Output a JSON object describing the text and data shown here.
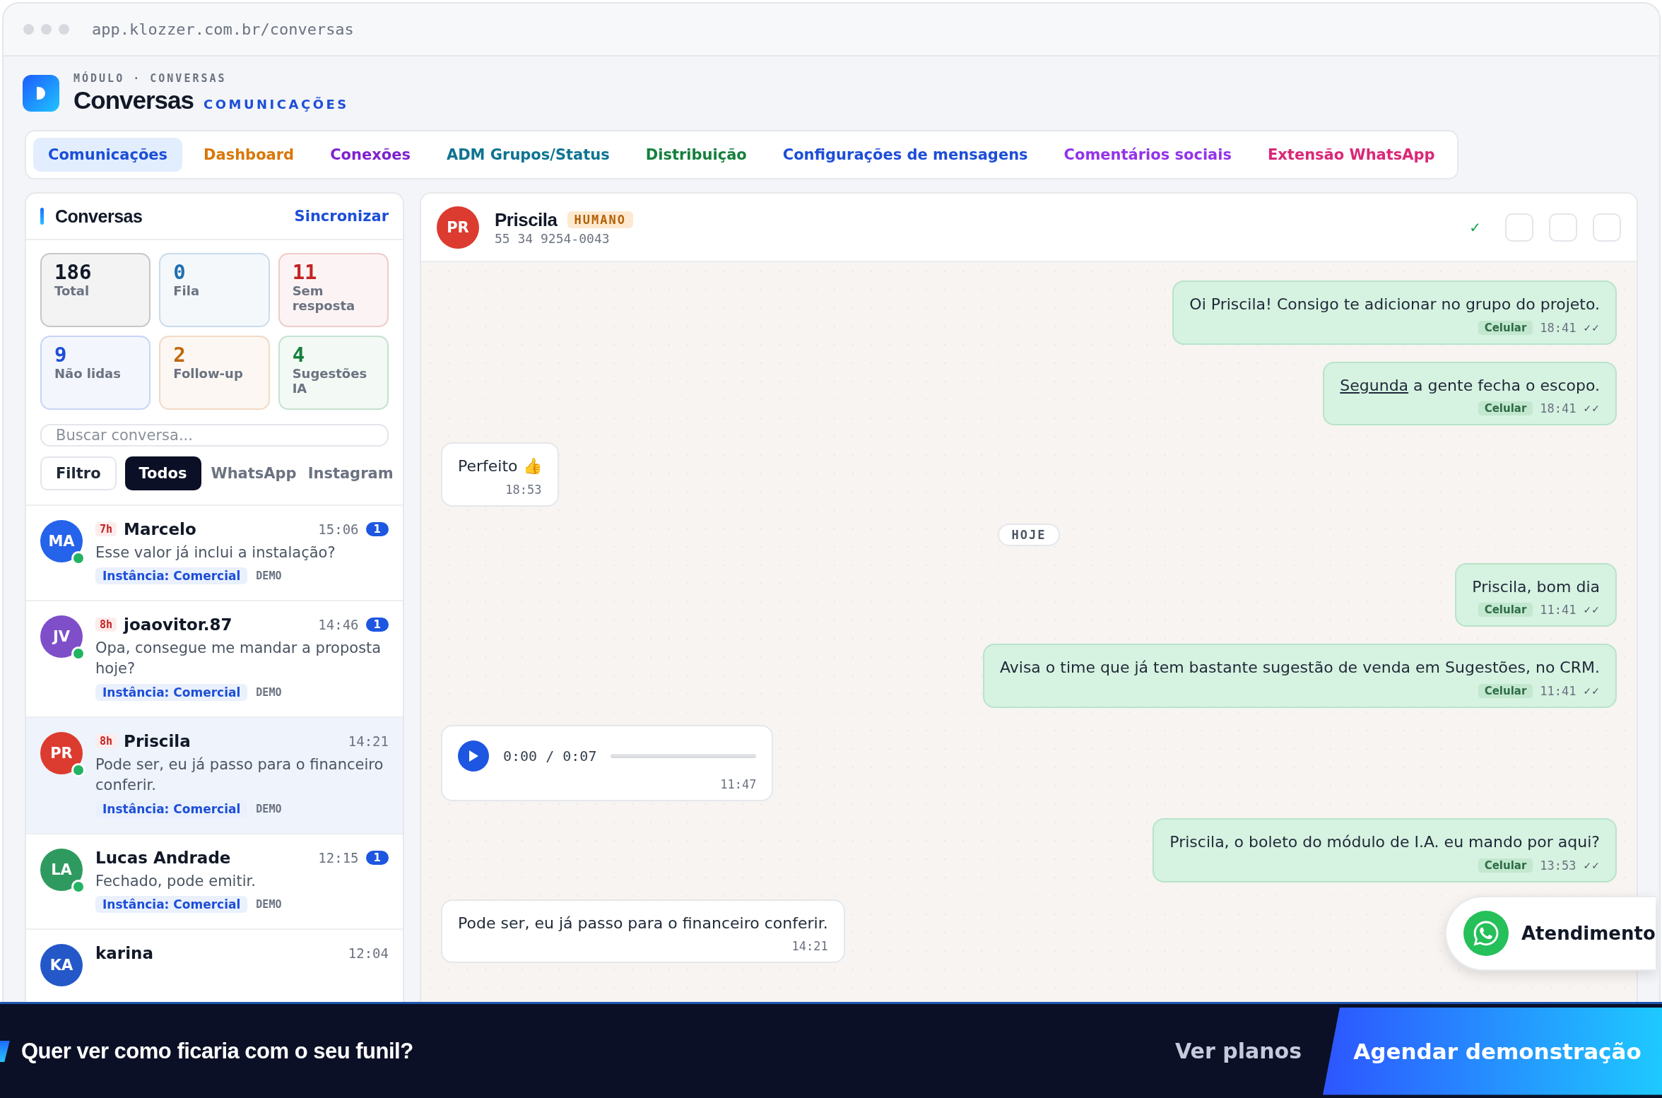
{
  "browser": {
    "url": "app.klozzer.com.br/conversas"
  },
  "header": {
    "eyebrow": "MÓDULO · CONVERSAS",
    "title": "Conversas",
    "subtitle": "COMUNICAÇÕES"
  },
  "tabs": [
    {
      "label": "Comunicações",
      "color": "#1d4ed8",
      "selected": true
    },
    {
      "label": "Dashboard",
      "color": "#d97706",
      "selected": false
    },
    {
      "label": "Conexões",
      "color": "#7e22ce",
      "selected": false
    },
    {
      "label": "ADM Grupos/Status",
      "color": "#0e7490",
      "selected": false
    },
    {
      "label": "Distribuição",
      "color": "#15803d",
      "selected": false
    },
    {
      "label": "Configurações de mensagens",
      "color": "#1d4ed8",
      "selected": false
    },
    {
      "label": "Comentários sociais",
      "color": "#9333ea",
      "selected": false
    },
    {
      "label": "Extensão WhatsApp",
      "color": "#db2777",
      "selected": false
    }
  ],
  "sidebar": {
    "title": "Conversas",
    "sync": "Sincronizar",
    "stats": [
      {
        "value": "186",
        "label": "Total",
        "color": "#111827"
      },
      {
        "value": "0",
        "label": "Fila",
        "color": "#1e6fb0"
      },
      {
        "value": "11",
        "label": "Sem resposta",
        "color": "#c42323"
      },
      {
        "value": "9",
        "label": "Não lidas",
        "color": "#1d4ed8"
      },
      {
        "value": "2",
        "label": "Follow-up",
        "color": "#c2660b"
      },
      {
        "value": "4",
        "label": "Sugestões IA",
        "color": "#16803c"
      }
    ],
    "search": {
      "placeholder": "Buscar conversa..."
    },
    "filters": [
      {
        "label": "Filtro",
        "kind": "button",
        "selected": false
      },
      {
        "label": "Todos",
        "kind": "chip",
        "selected": true
      },
      {
        "label": "WhatsApp",
        "kind": "chip",
        "selected": false
      },
      {
        "label": "Instagram",
        "kind": "chip",
        "selected": false
      }
    ],
    "contacts": [
      {
        "initials": "MA",
        "color": "#2563eb",
        "online": true,
        "age": "7h",
        "name": "Marcelo",
        "time": "15:06",
        "unread": "1",
        "preview": "Esse valor já inclui a instalação?",
        "instance": "Instância: Comercial",
        "tag": "DEMO",
        "selected": false
      },
      {
        "initials": "JV",
        "color": "#7e4fc9",
        "online": true,
        "age": "8h",
        "name": "joaovitor.87",
        "time": "14:46",
        "unread": "1",
        "preview": "Opa, consegue me mandar a proposta hoje?",
        "instance": "Instância: Comercial",
        "tag": "DEMO",
        "selected": false
      },
      {
        "initials": "PR",
        "color": "#dc3b2f",
        "online": true,
        "age": "8h",
        "name": "Priscila",
        "time": "14:21",
        "preview": "Pode ser, eu já passo para o financeiro conferir.",
        "instance": "Instância: Comercial",
        "tag": "DEMO",
        "selected": true
      },
      {
        "initials": "LA",
        "color": "#2f9a5f",
        "online": true,
        "name": "Lucas Andrade",
        "time": "12:15",
        "unread": "1",
        "preview": "Fechado, pode emitir.",
        "instance": "Instância: Comercial",
        "tag": "DEMO",
        "selected": false
      },
      {
        "initials": "KA",
        "color": "#2458c8",
        "name": "karina",
        "time": "12:04",
        "selected": false
      }
    ]
  },
  "chat": {
    "initials": "PR",
    "color": "#dc3b2f",
    "name": "Priscila",
    "badge": "HUMANO",
    "phone": "55 34 9254-0043",
    "status": "✓",
    "messages": [
      {
        "kind": "out",
        "text": "Oi Priscila! Consigo te adicionar no grupo do projeto.",
        "source": "Celular",
        "time": "18:41",
        "ticks": "✓✓"
      },
      {
        "kind": "out",
        "link": "Segunda",
        "text": " a gente fecha o escopo.",
        "source": "Celular",
        "time": "18:41",
        "ticks": "✓✓"
      },
      {
        "kind": "in",
        "text": "Perfeito 👍",
        "time": "18:53"
      },
      {
        "kind": "date",
        "text": "HOJE"
      },
      {
        "kind": "out",
        "text": "Priscila, bom dia",
        "source": "Celular",
        "time": "11:41",
        "ticks": "✓✓"
      },
      {
        "kind": "out",
        "text": "Avisa o time que já tem bastante sugestão de venda em Sugestões, no CRM.",
        "source": "Celular",
        "time": "11:41",
        "ticks": "✓✓"
      },
      {
        "kind": "audio",
        "text": "0:00 / 0:07",
        "time": "11:47"
      },
      {
        "kind": "out",
        "text": "Priscila, o boleto do módulo de I.A. eu mando por aqui?",
        "source": "Celular",
        "time": "13:53",
        "ticks": "✓✓"
      },
      {
        "kind": "in",
        "text": "Pode ser, eu já passo para o financeiro conferir.",
        "time": "14:21"
      }
    ]
  },
  "floating_button": {
    "label": "Atendimento"
  },
  "banner": {
    "text": "Quer ver como ficaria com o seu funil?",
    "link": "Ver planos",
    "button": "Agendar demonstração"
  }
}
